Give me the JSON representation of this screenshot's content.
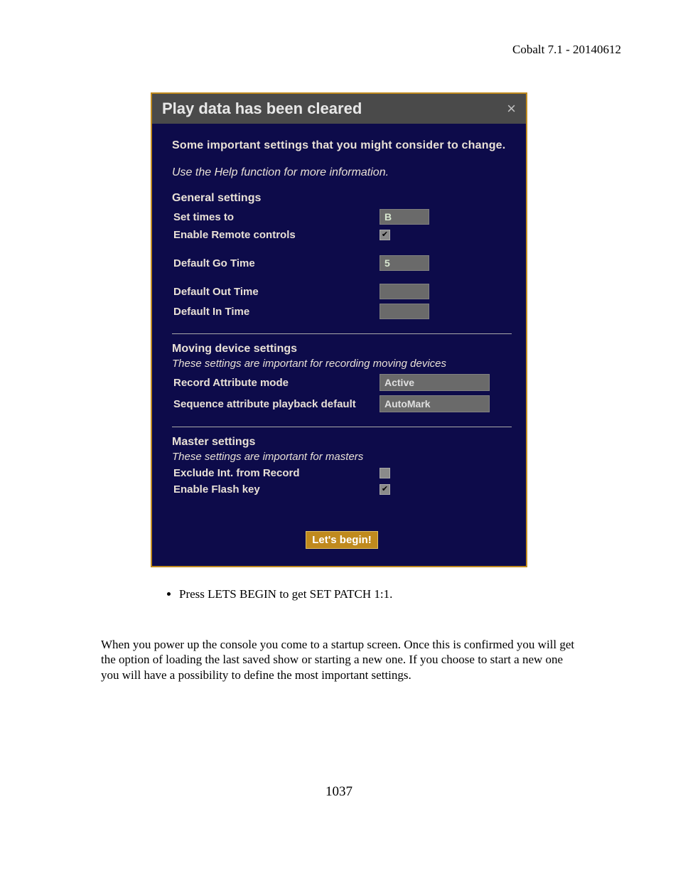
{
  "header": {
    "version": "Cobalt 7.1 - 20140612"
  },
  "dialog": {
    "title": "Play data has been cleared",
    "close_glyph": "×",
    "intro_bold": "Some important settings that you might consider to change.",
    "intro_italic": "Use the Help function for more information.",
    "general": {
      "title": "General settings",
      "set_times_label": "Set times to",
      "set_times_value": "B",
      "enable_remote_label": "Enable Remote controls",
      "enable_remote_checked": true,
      "default_go_label": "Default Go Time",
      "default_go_value": "5",
      "default_out_label": "Default Out Time",
      "default_out_value": "",
      "default_in_label": "Default In Time",
      "default_in_value": ""
    },
    "moving": {
      "title": "Moving device settings",
      "note": "These settings are important for recording moving devices",
      "record_attr_label": "Record Attribute mode",
      "record_attr_value": "Active",
      "seq_playback_label": "Sequence attribute playback default",
      "seq_playback_value": "AutoMark"
    },
    "master": {
      "title": "Master settings",
      "note": "These settings are important for masters",
      "exclude_int_label": "Exclude Int. from Record",
      "exclude_int_checked": false,
      "enable_flash_label": "Enable Flash key",
      "enable_flash_checked": true
    },
    "begin_label": "Let's begin!"
  },
  "bullet": "Press LETS BEGIN to get SET PATCH 1:1.",
  "body_text": "When you power up the console you come to a startup screen. Once this is confirmed you will get the option of loading the last saved show or starting a new one. If you choose to start a new one you will have a possibility to define the most important settings.",
  "page_number": "1037"
}
